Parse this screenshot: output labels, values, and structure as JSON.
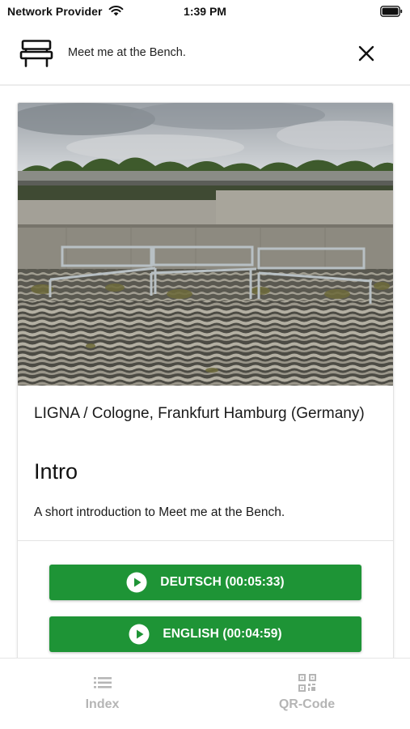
{
  "status_bar": {
    "carrier": "Network Provider",
    "time": "1:39 PM",
    "icons": [
      "wifi-icon",
      "battery-icon"
    ]
  },
  "header": {
    "title": "Meet me at the Bench.",
    "icon": "bench-icon",
    "close_icon": "close-icon"
  },
  "card": {
    "project": "LIGNA / Cologne, Frankfurt Hamburg (Germany)",
    "title": "Intro",
    "description": "A short introduction to Meet me at the Bench."
  },
  "audio_buttons": [
    {
      "label": "DEUTSCH (00:05:33)",
      "icon": "play-icon"
    },
    {
      "label": "ENGLISH (00:04:59)",
      "icon": "play-icon"
    }
  ],
  "tab_bar": {
    "tabs": [
      {
        "label": "Index",
        "icon": "list-icon"
      },
      {
        "label": "QR-Code",
        "icon": "qr-code-icon"
      }
    ]
  },
  "colors": {
    "accent_green": "#1e9436",
    "tab_inactive": "#b5b5b5"
  }
}
